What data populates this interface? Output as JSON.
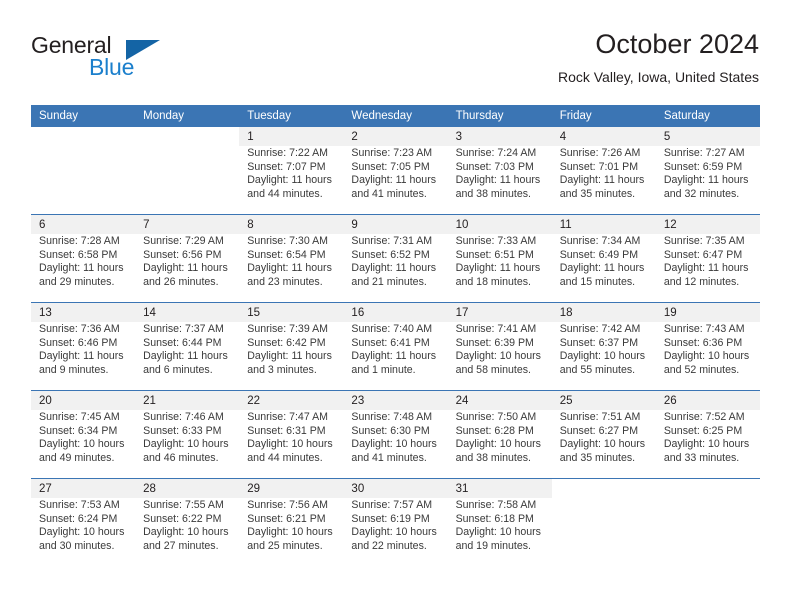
{
  "brand": {
    "name_top": "General",
    "name_bottom": "Blue",
    "triangle_color": "#1464a5",
    "blue_color": "#1b7fcc"
  },
  "header": {
    "title": "October 2024",
    "subtitle": "Rock Valley, Iowa, United States"
  },
  "theme": {
    "header_blue": "#3b75b4",
    "daynum_background": "#f1f1f1",
    "text_color": "#231f20",
    "info_text_color": "#3a3a3a"
  },
  "weekday_headers": [
    "Sunday",
    "Monday",
    "Tuesday",
    "Wednesday",
    "Thursday",
    "Friday",
    "Saturday"
  ],
  "labels": {
    "sunrise_prefix": "Sunrise:",
    "sunset_prefix": "Sunset:",
    "daylight_prefix": "Daylight:"
  },
  "weeks": [
    {
      "days": [
        {
          "day": "",
          "sunrise": "",
          "sunset": "",
          "daylight_line1": "",
          "daylight_line2": ""
        },
        {
          "day": "",
          "sunrise": "",
          "sunset": "",
          "daylight_line1": "",
          "daylight_line2": ""
        },
        {
          "day": "1",
          "sunrise": "Sunrise: 7:22 AM",
          "sunset": "Sunset: 7:07 PM",
          "daylight_line1": "Daylight: 11 hours",
          "daylight_line2": "and 44 minutes."
        },
        {
          "day": "2",
          "sunrise": "Sunrise: 7:23 AM",
          "sunset": "Sunset: 7:05 PM",
          "daylight_line1": "Daylight: 11 hours",
          "daylight_line2": "and 41 minutes."
        },
        {
          "day": "3",
          "sunrise": "Sunrise: 7:24 AM",
          "sunset": "Sunset: 7:03 PM",
          "daylight_line1": "Daylight: 11 hours",
          "daylight_line2": "and 38 minutes."
        },
        {
          "day": "4",
          "sunrise": "Sunrise: 7:26 AM",
          "sunset": "Sunset: 7:01 PM",
          "daylight_line1": "Daylight: 11 hours",
          "daylight_line2": "and 35 minutes."
        },
        {
          "day": "5",
          "sunrise": "Sunrise: 7:27 AM",
          "sunset": "Sunset: 6:59 PM",
          "daylight_line1": "Daylight: 11 hours",
          "daylight_line2": "and 32 minutes."
        }
      ]
    },
    {
      "days": [
        {
          "day": "6",
          "sunrise": "Sunrise: 7:28 AM",
          "sunset": "Sunset: 6:58 PM",
          "daylight_line1": "Daylight: 11 hours",
          "daylight_line2": "and 29 minutes."
        },
        {
          "day": "7",
          "sunrise": "Sunrise: 7:29 AM",
          "sunset": "Sunset: 6:56 PM",
          "daylight_line1": "Daylight: 11 hours",
          "daylight_line2": "and 26 minutes."
        },
        {
          "day": "8",
          "sunrise": "Sunrise: 7:30 AM",
          "sunset": "Sunset: 6:54 PM",
          "daylight_line1": "Daylight: 11 hours",
          "daylight_line2": "and 23 minutes."
        },
        {
          "day": "9",
          "sunrise": "Sunrise: 7:31 AM",
          "sunset": "Sunset: 6:52 PM",
          "daylight_line1": "Daylight: 11 hours",
          "daylight_line2": "and 21 minutes."
        },
        {
          "day": "10",
          "sunrise": "Sunrise: 7:33 AM",
          "sunset": "Sunset: 6:51 PM",
          "daylight_line1": "Daylight: 11 hours",
          "daylight_line2": "and 18 minutes."
        },
        {
          "day": "11",
          "sunrise": "Sunrise: 7:34 AM",
          "sunset": "Sunset: 6:49 PM",
          "daylight_line1": "Daylight: 11 hours",
          "daylight_line2": "and 15 minutes."
        },
        {
          "day": "12",
          "sunrise": "Sunrise: 7:35 AM",
          "sunset": "Sunset: 6:47 PM",
          "daylight_line1": "Daylight: 11 hours",
          "daylight_line2": "and 12 minutes."
        }
      ]
    },
    {
      "days": [
        {
          "day": "13",
          "sunrise": "Sunrise: 7:36 AM",
          "sunset": "Sunset: 6:46 PM",
          "daylight_line1": "Daylight: 11 hours",
          "daylight_line2": "and 9 minutes."
        },
        {
          "day": "14",
          "sunrise": "Sunrise: 7:37 AM",
          "sunset": "Sunset: 6:44 PM",
          "daylight_line1": "Daylight: 11 hours",
          "daylight_line2": "and 6 minutes."
        },
        {
          "day": "15",
          "sunrise": "Sunrise: 7:39 AM",
          "sunset": "Sunset: 6:42 PM",
          "daylight_line1": "Daylight: 11 hours",
          "daylight_line2": "and 3 minutes."
        },
        {
          "day": "16",
          "sunrise": "Sunrise: 7:40 AM",
          "sunset": "Sunset: 6:41 PM",
          "daylight_line1": "Daylight: 11 hours",
          "daylight_line2": "and 1 minute."
        },
        {
          "day": "17",
          "sunrise": "Sunrise: 7:41 AM",
          "sunset": "Sunset: 6:39 PM",
          "daylight_line1": "Daylight: 10 hours",
          "daylight_line2": "and 58 minutes."
        },
        {
          "day": "18",
          "sunrise": "Sunrise: 7:42 AM",
          "sunset": "Sunset: 6:37 PM",
          "daylight_line1": "Daylight: 10 hours",
          "daylight_line2": "and 55 minutes."
        },
        {
          "day": "19",
          "sunrise": "Sunrise: 7:43 AM",
          "sunset": "Sunset: 6:36 PM",
          "daylight_line1": "Daylight: 10 hours",
          "daylight_line2": "and 52 minutes."
        }
      ]
    },
    {
      "days": [
        {
          "day": "20",
          "sunrise": "Sunrise: 7:45 AM",
          "sunset": "Sunset: 6:34 PM",
          "daylight_line1": "Daylight: 10 hours",
          "daylight_line2": "and 49 minutes."
        },
        {
          "day": "21",
          "sunrise": "Sunrise: 7:46 AM",
          "sunset": "Sunset: 6:33 PM",
          "daylight_line1": "Daylight: 10 hours",
          "daylight_line2": "and 46 minutes."
        },
        {
          "day": "22",
          "sunrise": "Sunrise: 7:47 AM",
          "sunset": "Sunset: 6:31 PM",
          "daylight_line1": "Daylight: 10 hours",
          "daylight_line2": "and 44 minutes."
        },
        {
          "day": "23",
          "sunrise": "Sunrise: 7:48 AM",
          "sunset": "Sunset: 6:30 PM",
          "daylight_line1": "Daylight: 10 hours",
          "daylight_line2": "and 41 minutes."
        },
        {
          "day": "24",
          "sunrise": "Sunrise: 7:50 AM",
          "sunset": "Sunset: 6:28 PM",
          "daylight_line1": "Daylight: 10 hours",
          "daylight_line2": "and 38 minutes."
        },
        {
          "day": "25",
          "sunrise": "Sunrise: 7:51 AM",
          "sunset": "Sunset: 6:27 PM",
          "daylight_line1": "Daylight: 10 hours",
          "daylight_line2": "and 35 minutes."
        },
        {
          "day": "26",
          "sunrise": "Sunrise: 7:52 AM",
          "sunset": "Sunset: 6:25 PM",
          "daylight_line1": "Daylight: 10 hours",
          "daylight_line2": "and 33 minutes."
        }
      ]
    },
    {
      "days": [
        {
          "day": "27",
          "sunrise": "Sunrise: 7:53 AM",
          "sunset": "Sunset: 6:24 PM",
          "daylight_line1": "Daylight: 10 hours",
          "daylight_line2": "and 30 minutes."
        },
        {
          "day": "28",
          "sunrise": "Sunrise: 7:55 AM",
          "sunset": "Sunset: 6:22 PM",
          "daylight_line1": "Daylight: 10 hours",
          "daylight_line2": "and 27 minutes."
        },
        {
          "day": "29",
          "sunrise": "Sunrise: 7:56 AM",
          "sunset": "Sunset: 6:21 PM",
          "daylight_line1": "Daylight: 10 hours",
          "daylight_line2": "and 25 minutes."
        },
        {
          "day": "30",
          "sunrise": "Sunrise: 7:57 AM",
          "sunset": "Sunset: 6:19 PM",
          "daylight_line1": "Daylight: 10 hours",
          "daylight_line2": "and 22 minutes."
        },
        {
          "day": "31",
          "sunrise": "Sunrise: 7:58 AM",
          "sunset": "Sunset: 6:18 PM",
          "daylight_line1": "Daylight: 10 hours",
          "daylight_line2": "and 19 minutes."
        },
        {
          "day": "",
          "sunrise": "",
          "sunset": "",
          "daylight_line1": "",
          "daylight_line2": ""
        },
        {
          "day": "",
          "sunrise": "",
          "sunset": "",
          "daylight_line1": "",
          "daylight_line2": ""
        }
      ]
    }
  ]
}
